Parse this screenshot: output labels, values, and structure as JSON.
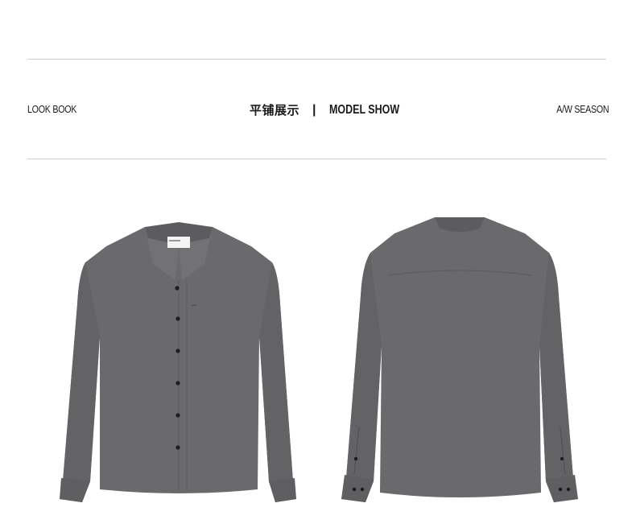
{
  "header": {
    "left_label": "LOOK BOOK",
    "center_cn": "平铺展示",
    "center_divider": "|",
    "center_en": "MODEL SHOW",
    "right_label": "A/W SEASON"
  },
  "products": {
    "shirt_color": "#6a6a6c",
    "shirt_shadow": "#59595b",
    "button_color": "#1c1c1e"
  }
}
